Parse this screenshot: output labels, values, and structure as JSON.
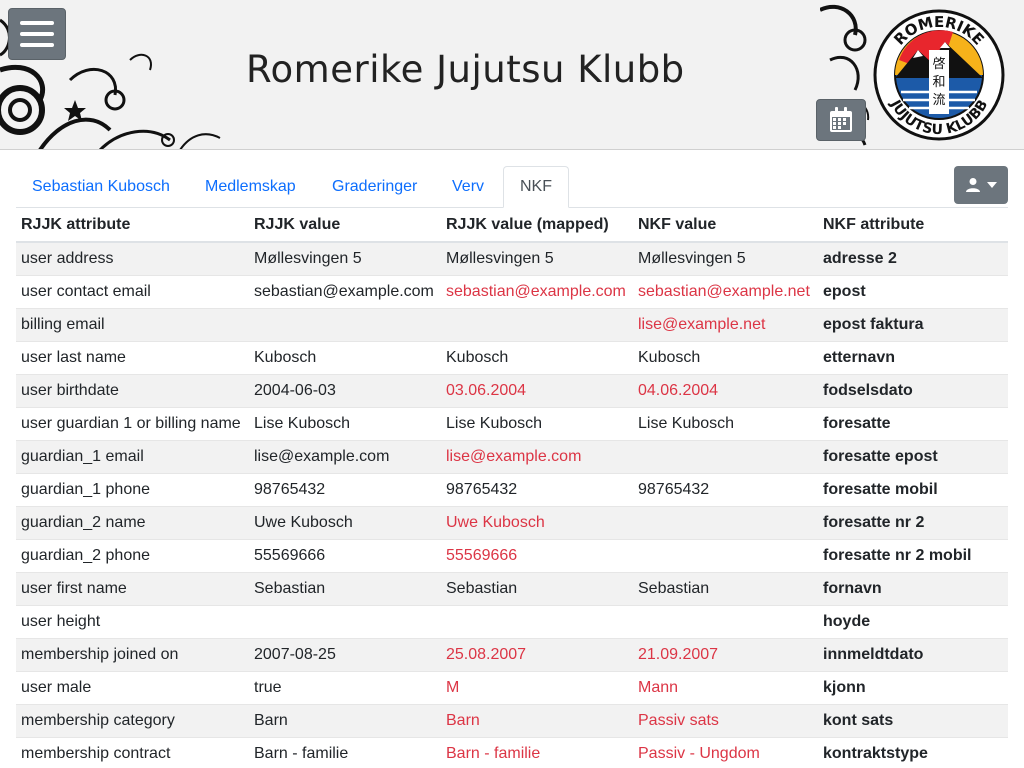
{
  "header": {
    "title": "Romerike Jujutsu Klubb",
    "logo_top_text": "ROMERIKE",
    "logo_bottom_text": "JUJUTSU KLUBB",
    "logo_kanji": [
      "啓",
      "和",
      "流"
    ]
  },
  "tabs": [
    {
      "label": "Sebastian Kubosch",
      "active": false
    },
    {
      "label": "Medlemskap",
      "active": false
    },
    {
      "label": "Graderinger",
      "active": false
    },
    {
      "label": "Verv",
      "active": false
    },
    {
      "label": "NKF",
      "active": true
    }
  ],
  "table": {
    "columns": [
      "RJJK attribute",
      "RJJK value",
      "RJJK value (mapped)",
      "NKF value",
      "NKF attribute"
    ],
    "rows": [
      {
        "attr": "user address",
        "value": "Møllesvingen 5",
        "mapped": "Møllesvingen 5",
        "nkf_value": "Møllesvingen 5",
        "nkf_attr": "adresse 2",
        "mapped_diff": false,
        "nkf_diff": false
      },
      {
        "attr": "user contact email",
        "value": "sebastian@example.com",
        "mapped": "sebastian@example.com",
        "nkf_value": "sebastian@example.net",
        "nkf_attr": "epost",
        "mapped_diff": true,
        "nkf_diff": true
      },
      {
        "attr": "billing email",
        "value": "",
        "mapped": "",
        "nkf_value": "lise@example.net",
        "nkf_attr": "epost faktura",
        "mapped_diff": false,
        "nkf_diff": true
      },
      {
        "attr": "user last name",
        "value": "Kubosch",
        "mapped": "Kubosch",
        "nkf_value": "Kubosch",
        "nkf_attr": "etternavn",
        "mapped_diff": false,
        "nkf_diff": false
      },
      {
        "attr": "user birthdate",
        "value": "2004-06-03",
        "mapped": "03.06.2004",
        "nkf_value": "04.06.2004",
        "nkf_attr": "fodselsdato",
        "mapped_diff": true,
        "nkf_diff": true
      },
      {
        "attr": "user guardian 1 or billing name",
        "value": "Lise Kubosch",
        "mapped": "Lise Kubosch",
        "nkf_value": "Lise Kubosch",
        "nkf_attr": "foresatte",
        "mapped_diff": false,
        "nkf_diff": false
      },
      {
        "attr": "guardian_1 email",
        "value": "lise@example.com",
        "mapped": "lise@example.com",
        "nkf_value": "",
        "nkf_attr": "foresatte epost",
        "mapped_diff": true,
        "nkf_diff": false
      },
      {
        "attr": "guardian_1 phone",
        "value": "98765432",
        "mapped": "98765432",
        "nkf_value": "98765432",
        "nkf_attr": "foresatte mobil",
        "mapped_diff": false,
        "nkf_diff": false
      },
      {
        "attr": "guardian_2 name",
        "value": "Uwe Kubosch",
        "mapped": "Uwe Kubosch",
        "nkf_value": "",
        "nkf_attr": "foresatte nr 2",
        "mapped_diff": true,
        "nkf_diff": false
      },
      {
        "attr": "guardian_2 phone",
        "value": "55569666",
        "mapped": "55569666",
        "nkf_value": "",
        "nkf_attr": "foresatte nr 2 mobil",
        "mapped_diff": true,
        "nkf_diff": false
      },
      {
        "attr": "user first name",
        "value": "Sebastian",
        "mapped": "Sebastian",
        "nkf_value": "Sebastian",
        "nkf_attr": "fornavn",
        "mapped_diff": false,
        "nkf_diff": false
      },
      {
        "attr": "user height",
        "value": "",
        "mapped": "",
        "nkf_value": "",
        "nkf_attr": "hoyde",
        "mapped_diff": false,
        "nkf_diff": false
      },
      {
        "attr": "membership joined on",
        "value": "2007-08-25",
        "mapped": "25.08.2007",
        "nkf_value": "21.09.2007",
        "nkf_attr": "innmeldtdato",
        "mapped_diff": true,
        "nkf_diff": true
      },
      {
        "attr": "user male",
        "value": "true",
        "mapped": "M",
        "nkf_value": "Mann",
        "nkf_attr": "kjonn",
        "mapped_diff": true,
        "nkf_diff": true
      },
      {
        "attr": "membership category",
        "value": "Barn",
        "mapped": "Barn",
        "nkf_value": "Passiv sats",
        "nkf_attr": "kont sats",
        "mapped_diff": true,
        "nkf_diff": true
      },
      {
        "attr": "membership contract",
        "value": "Barn - familie",
        "mapped": "Barn - familie",
        "nkf_value": "Passiv - Ungdom",
        "nkf_attr": "kontraktstype",
        "mapped_diff": true,
        "nkf_diff": true
      }
    ]
  },
  "colors": {
    "diff": "#dc3545",
    "link": "#0d6efd",
    "button": "#6c757d",
    "logo_red": "#e8262d",
    "logo_yellow": "#f6b21a",
    "logo_blue": "#1c5aa8"
  },
  "icons": {
    "menu": "hamburger-icon",
    "calendar": "calendar-icon",
    "user": "user-icon",
    "dropdown": "caret-down-icon"
  }
}
